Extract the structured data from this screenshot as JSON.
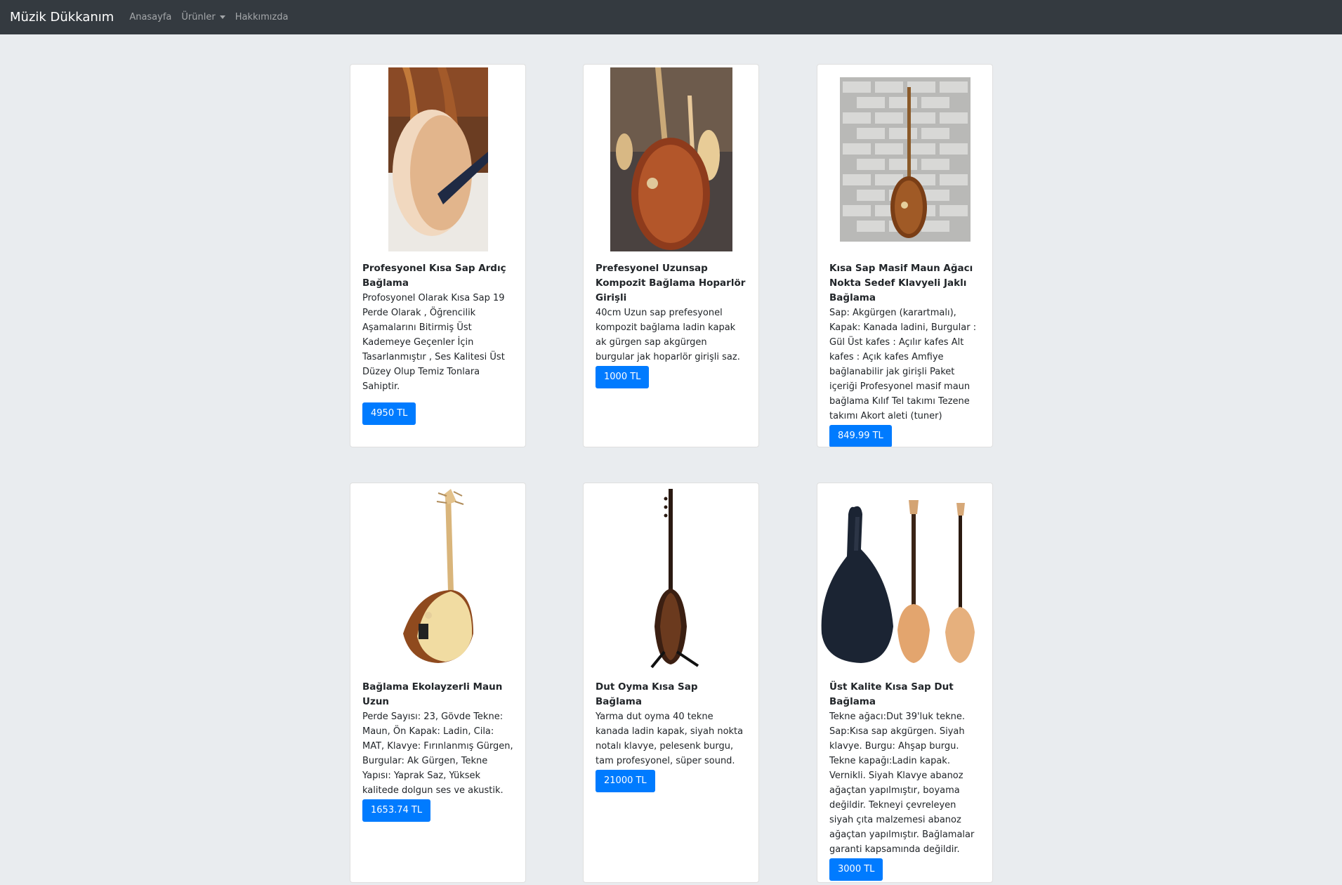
{
  "navbar": {
    "brand": "Müzik Dükkanım",
    "links": [
      {
        "label": "Anasayfa"
      },
      {
        "label": "Ürünler"
      },
      {
        "label": "Hakkımızda"
      }
    ]
  },
  "colors": {
    "navbar_bg": "#343a40",
    "page_bg": "#e9ecef",
    "button_primary": "#007bff"
  },
  "products": [
    {
      "image": "baglama-short-neck-photo",
      "title": "Profesyonel Kısa Sap Ardıç Bağlama",
      "description": "Profosyonel Olarak Kısa Sap 19 Perde Olarak , Öğrencilik Aşamalarını Bitirmiş Üst Kademeye Geçenler İçin Tasarlanmıştır , Ses Kalitesi Üst Düzey Olup Temiz Tonlara Sahiptir.",
      "price": "4950 TL"
    },
    {
      "image": "baglama-long-neck-photo",
      "title": "Prefesyonel Uzunsap Kompozit Bağlama Hoparlör Girişli",
      "description": "40cm Uzun sap prefesyonel kompozit bağlama ladin kapak ak gürgen sap akgürgen burgular jak hoparlör girişli saz.",
      "price": "1000 TL"
    },
    {
      "image": "baglama-on-brick-wall-photo",
      "title": "Kısa Sap Masif Maun Ağacı Nokta Sedef Klavyeli Jaklı Bağlama",
      "description": "Sap: Akgürgen (karartmalı), Kapak: Kanada ladini, Burgular : Gül Üst kafes : Açılır kafes Alt kafes : Açık kafes Amfiye bağlanabilir jak girişli Paket içeriği Profesyonel masif maun bağlama Kılıf Tel takımı Tezene takımı Akort aleti (tuner)",
      "price": "849.99 TL"
    },
    {
      "image": "baglama-electro-photo",
      "title": "Bağlama Ekolayzerli Maun Uzun",
      "description": "Perde Sayısı: 23, Gövde Tekne: Maun, Ön Kapak: Ladin, Cila: MAT, Klavye: Fırınlanmış Gürgen, Burgular: Ak Gürgen, Tekne Yapısı: Yaprak Saz, Yüksek kalitede dolgun ses ve akustik.",
      "price": "1653.74 TL"
    },
    {
      "image": "baglama-dut-oyma-photo",
      "title": "Dut Oyma Kısa Sap Bağlama",
      "description": "Yarma dut oyma 40 tekne kanada ladin kapak, siyah nokta notalı klavye, pelesenk burgu, tam profesyonel, süper sound.",
      "price": "21000 TL"
    },
    {
      "image": "baglama-with-case-photo",
      "title": "Üst Kalite Kısa Sap Dut Bağlama",
      "description": "Tekne ağacı:Dut 39'luk tekne. Sap:Kısa sap akgürgen. Siyah klavye. Burgu: Ahşap burgu. Tekne kapağı:Ladin kapak. Vernikli. Siyah Klavye abanoz ağaçtan yapılmıştır, boyama değildir. Tekneyi çevreleyen siyah çıta malzemesi abanoz ağaçtan yapılmıştır. Bağlamalar garanti kapsamında değildir.",
      "price": "3000 TL"
    }
  ]
}
